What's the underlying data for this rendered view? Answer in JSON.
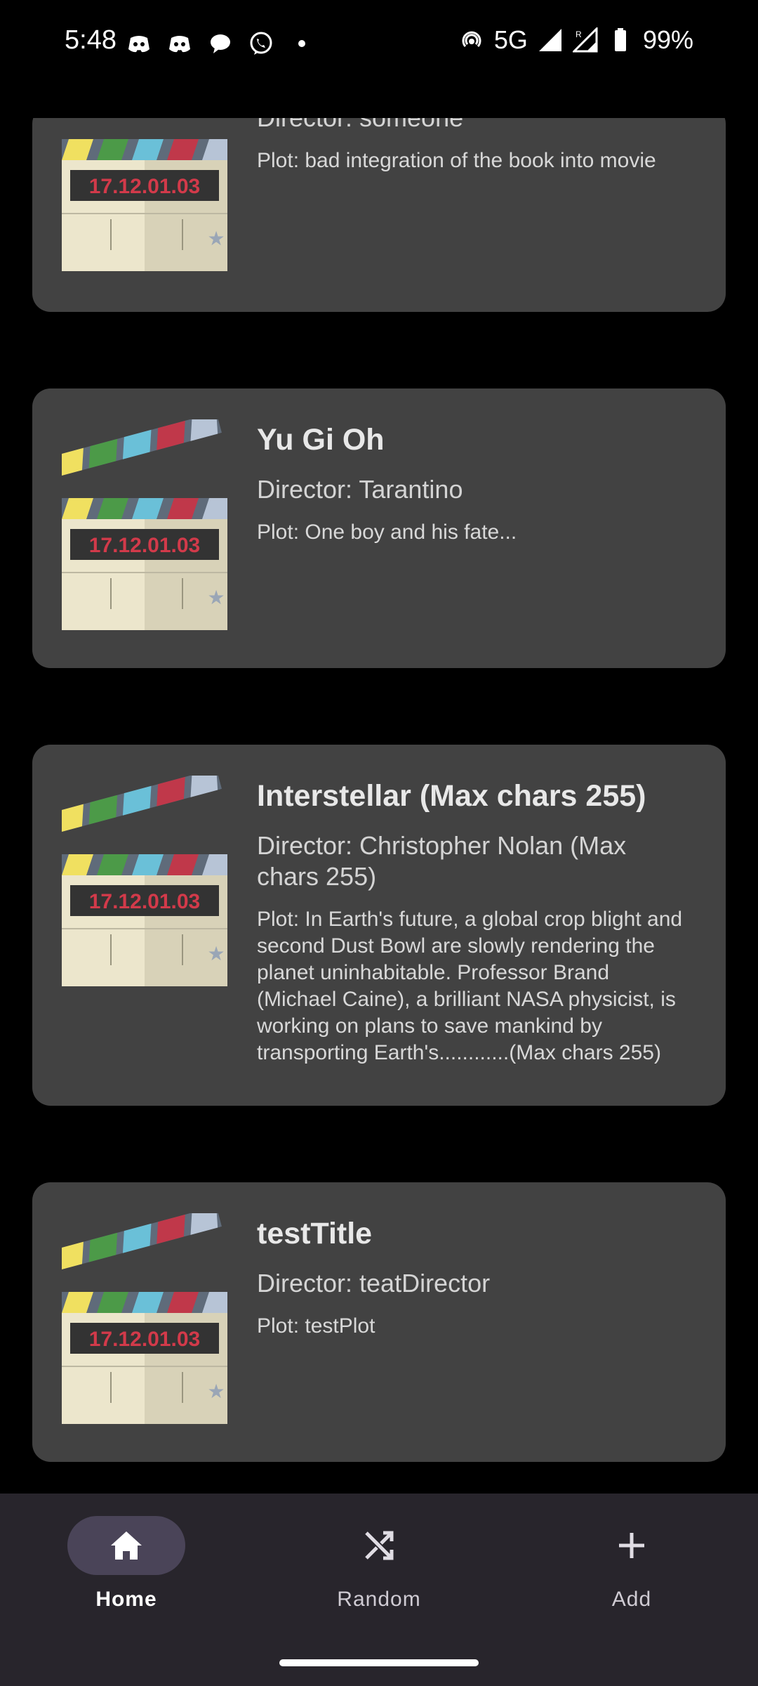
{
  "status_bar": {
    "time": "5:48",
    "network": "5G",
    "battery": "99%",
    "notification_icons": [
      "discord-icon",
      "discord-icon",
      "chat-bubble-icon",
      "viber-icon",
      "dot-icon"
    ],
    "right_icons": [
      "hotspot-icon",
      "signal-icon",
      "roaming-signal-icon",
      "battery-icon"
    ]
  },
  "movies": [
    {
      "title": "",
      "director": "Director: someone",
      "plot": "Plot: bad integration of the book into movie",
      "thumb_date": "17.12.01.03"
    },
    {
      "title": "Yu Gi Oh",
      "director": "Director: Tarantino",
      "plot": "Plot: One boy and his fate...",
      "thumb_date": "17.12.01.03"
    },
    {
      "title": "Interstellar (Max chars 255)",
      "director": "Director: Christopher Nolan (Max chars 255)",
      "plot": "Plot: In Earth's future, a global crop blight and second Dust Bowl are slowly rendering the planet uninhabitable. Professor Brand (Michael Caine), a brilliant NASA physicist, is working on plans to save mankind by transporting Earth's............(Max chars 255)",
      "thumb_date": "17.12.01.03"
    },
    {
      "title": "testTitle",
      "director": "Director: teatDirector",
      "plot": "Plot: testPlot",
      "thumb_date": "17.12.01.03"
    }
  ],
  "bottom_nav": {
    "items": [
      {
        "label": "Home",
        "icon": "home-icon",
        "active": true
      },
      {
        "label": "Random",
        "icon": "shuffle-icon",
        "active": false
      },
      {
        "label": "Add",
        "icon": "plus-icon",
        "active": false
      }
    ]
  },
  "colors": {
    "card_bg": "#424242",
    "nav_bg": "#28252c",
    "active_pill": "#4a4458"
  }
}
